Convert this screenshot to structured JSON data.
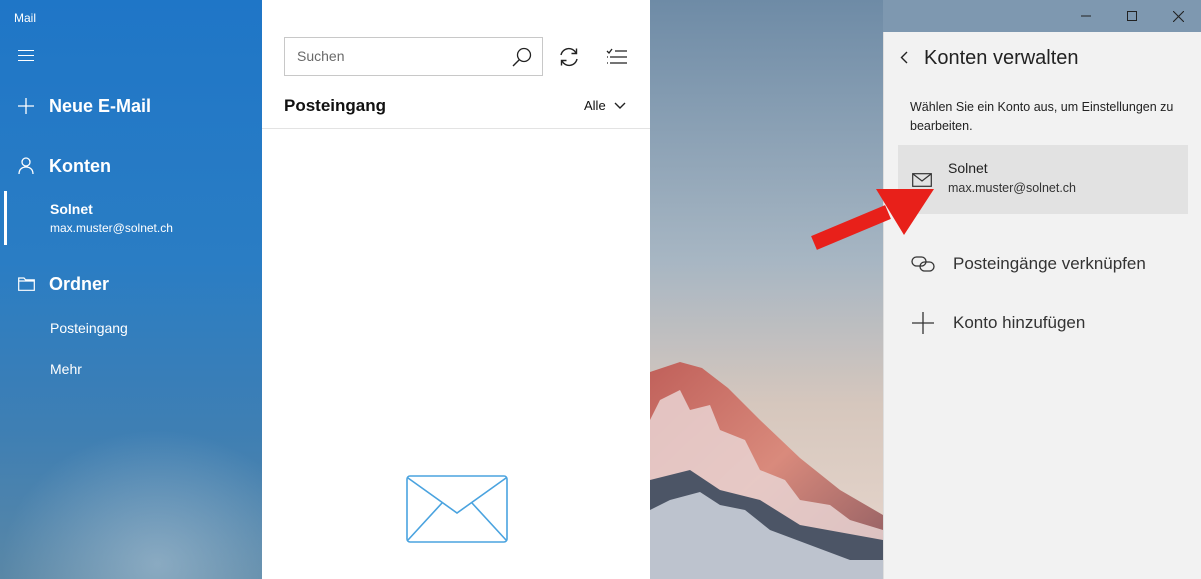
{
  "app": {
    "title": "Mail"
  },
  "sidebar": {
    "new_mail": "Neue E-Mail",
    "accounts_header": "Konten",
    "account": {
      "name": "Solnet",
      "email": "max.muster@solnet.ch"
    },
    "folders_header": "Ordner",
    "folders": [
      "Posteingang",
      "Mehr"
    ]
  },
  "list": {
    "search_placeholder": "Suchen",
    "title": "Posteingang",
    "filter_label": "Alle"
  },
  "panel": {
    "title": "Konten verwalten",
    "description": "Wählen Sie ein Konto aus, um Einstellungen zu bearbeiten.",
    "account": {
      "name": "Solnet",
      "email": "max.muster@solnet.ch"
    },
    "link_inboxes": "Posteingänge verknüpfen",
    "add_account": "Konto hinzufügen"
  },
  "colors": {
    "accent": "#1f76c7",
    "arrow": "#e8201a",
    "envelope": "#4aa3df"
  }
}
